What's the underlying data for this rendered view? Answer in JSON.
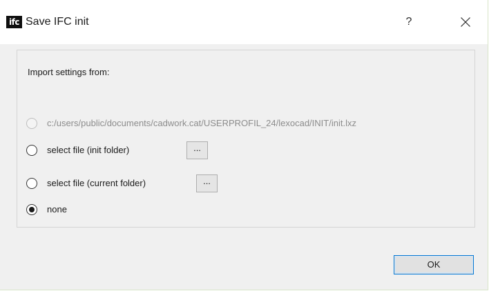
{
  "window": {
    "title": "Save IFC init",
    "app_icon_text": "ifc",
    "help_label": "?",
    "close_icon": "close-icon"
  },
  "group": {
    "label": "Import settings from:"
  },
  "options": [
    {
      "label": "c:/users/public/documents/cadwork.cat/USERPROFIL_24/lexocad/INIT/init.lxz",
      "checked": false,
      "enabled": false
    },
    {
      "label": "select file (init folder)",
      "checked": false,
      "enabled": true,
      "browse_label": "..."
    },
    {
      "label": "select file (current folder)",
      "checked": false,
      "enabled": true,
      "browse_label": "..."
    },
    {
      "label": "none",
      "checked": true,
      "enabled": true
    }
  ],
  "footer": {
    "ok_label": "OK"
  },
  "colors": {
    "accent": "#0078d7",
    "client_bg": "#f0f0f0",
    "disabled_text": "#8c8c8c"
  }
}
